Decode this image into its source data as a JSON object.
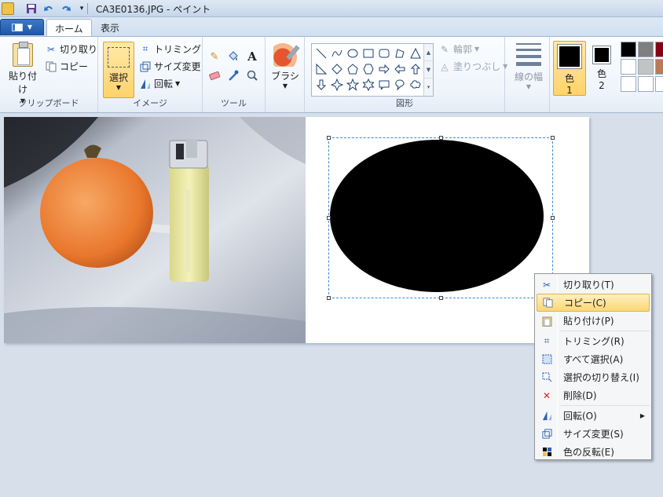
{
  "titlebar": {
    "title": "CA3E0136.JPG - ペイント",
    "quick_access": [
      "paint-app-icon",
      "save-icon",
      "undo-icon",
      "redo-icon",
      "customize-icon"
    ]
  },
  "tabs": {
    "home": "ホーム",
    "view": "表示"
  },
  "ribbon": {
    "clipboard": {
      "label": "クリップボード",
      "paste": "貼り付け",
      "cut": "切り取り",
      "copy": "コピー"
    },
    "image": {
      "label": "イメージ",
      "select": "選択",
      "crop": "トリミング",
      "resize": "サイズ変更",
      "rotate": "回転"
    },
    "tools": {
      "label": "ツール"
    },
    "brush": {
      "label": "ブラシ"
    },
    "shapes": {
      "label": "図形",
      "outline": "輪郭",
      "fill": "塗りつぶし"
    },
    "line_width": "線の幅",
    "color1": "色\n1",
    "color1_line1": "色",
    "color1_line2": "1",
    "color2_line1": "色",
    "color2_line2": "2",
    "palette": [
      "#000000",
      "#7f7f7f",
      "#880015",
      "#ffffff",
      "#c3c3c3",
      "#b97a57",
      "#ffffff",
      "#ffffff",
      "#ffffff"
    ]
  },
  "context_menu": {
    "items": [
      {
        "label": "切り取り(T)",
        "icon": "scissors-icon"
      },
      {
        "label": "コピー(C)",
        "icon": "copy-icon",
        "highlighted": true
      },
      {
        "label": "貼り付け(P)",
        "icon": "paste-icon"
      },
      {
        "label": "トリミング(R)",
        "icon": "crop-icon"
      },
      {
        "label": "すべて選択(A)",
        "icon": "select-all-icon"
      },
      {
        "label": "選択の切り替え(I)",
        "icon": "invert-selection-icon"
      },
      {
        "label": "削除(D)",
        "icon": "delete-icon"
      },
      {
        "label": "回転(O)",
        "icon": "rotate-icon",
        "submenu": true
      },
      {
        "label": "サイズ変更(S)",
        "icon": "resize-icon"
      },
      {
        "label": "色の反転(E)",
        "icon": "invert-color-icon"
      }
    ]
  }
}
